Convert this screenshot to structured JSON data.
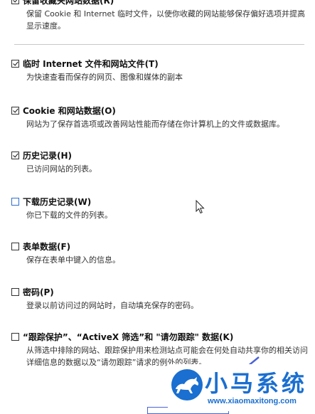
{
  "top_item": {
    "title": "保留收藏夹网站数据(R)",
    "checked": true,
    "description": "保留 Cookie 和 Internet 临时文件，以使你收藏的网站能够保存偏好选项并提高显示速度。"
  },
  "items": [
    {
      "key": "temp-files",
      "title": "临时 Internet 文件和网站文件(T)",
      "checked": true,
      "description": "为快速查看而保存的网页、图像和媒体的副本"
    },
    {
      "key": "cookies",
      "title": "Cookie 和网站数据(O)",
      "checked": true,
      "description": "网站为了保存首选项或改善网站性能而存储在你计算机上的文件或数据库。"
    },
    {
      "key": "history",
      "title": "历史记录(H)",
      "checked": true,
      "description": "已访问网站的列表。"
    },
    {
      "key": "download-history",
      "title": "下载历史记录(W)",
      "checked": false,
      "description": "你已下载的文件的列表。"
    },
    {
      "key": "form-data",
      "title": "表单数据(F)",
      "checked": false,
      "description": "保存在表单中键入的信息。"
    },
    {
      "key": "passwords",
      "title": "密码(P)",
      "checked": false,
      "description": "登录以前访问过的网站时，自动填充保存的密码。"
    },
    {
      "key": "tracking",
      "title": "“跟踪保护”、“ActiveX 筛选”和 \"请勿跟踪\" 数据(K)",
      "checked": false,
      "description": "从筛选中排除的网站、跟踪保护用来检测站点可能会在何处自动共享你的相关访问详细信息的数据以及“请勿跟踪”请求的例外的列表。"
    }
  ],
  "watermark": {
    "brand": "小马系统",
    "url": "www.xiaomaxitong.com",
    "color": "#1a6fd0"
  }
}
